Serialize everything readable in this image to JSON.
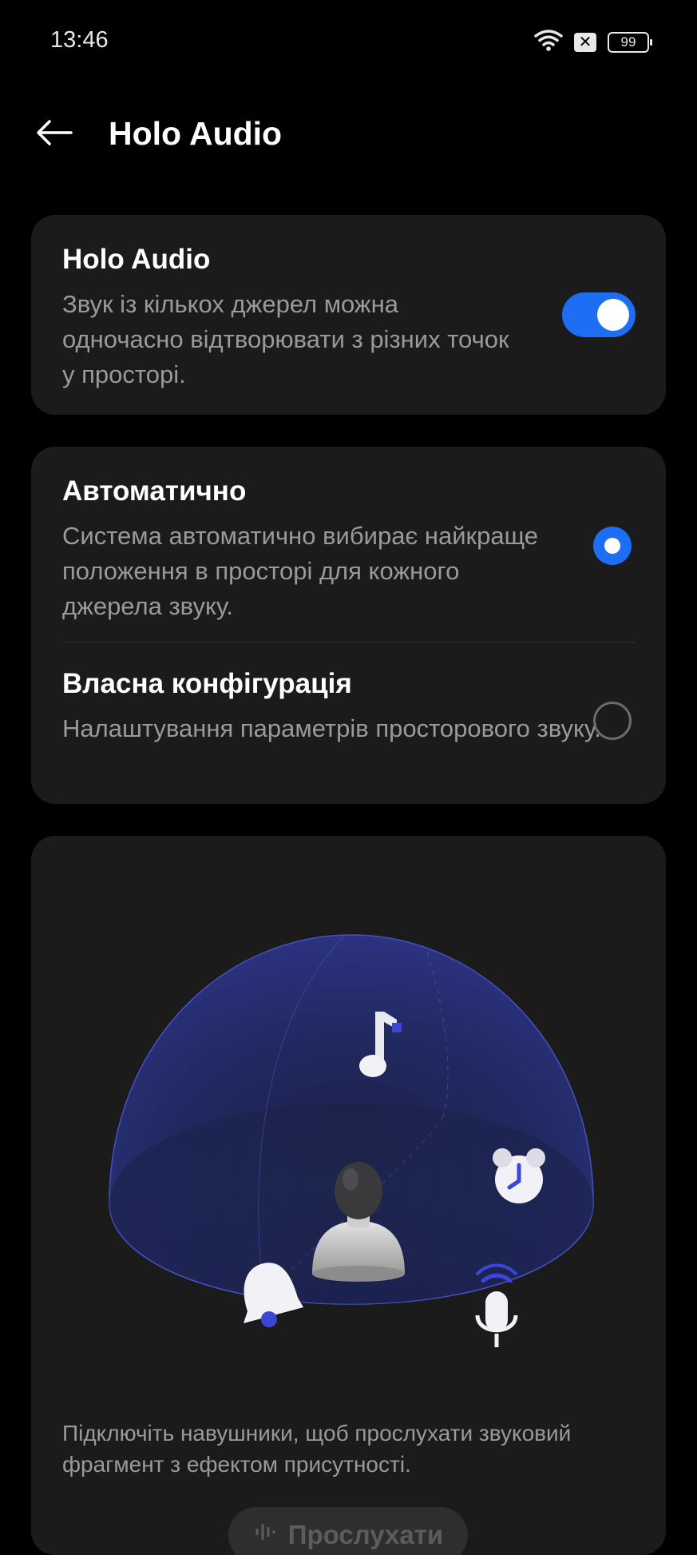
{
  "status_bar": {
    "time": "13:46",
    "battery": "99",
    "icons": [
      "wifi-icon",
      "sim-x-icon",
      "battery-icon"
    ]
  },
  "app_bar": {
    "title": "Holo Audio",
    "back_icon": "arrow-left-icon"
  },
  "holo_card": {
    "title": "Holo Audio",
    "description": "Звук із кількох джерел можна одночасно відтворювати з різних точок у просторі.",
    "toggle_on": true
  },
  "mode_card": {
    "options": [
      {
        "title": "Автоматично",
        "description": "Система автоматично вибирає найкраще положення в просторі для кожного джерела звуку.",
        "selected": true
      },
      {
        "title": "Власна конфігурація",
        "description": "Налаштування параметрів просторового звуку.",
        "selected": false
      }
    ]
  },
  "preview_card": {
    "hint": "Підключіть навушники, щоб прослухати звуковий фрагмент з ефектом присутності.",
    "play_label": "Прослухати",
    "illustration_icons": [
      "music-note-icon",
      "alarm-clock-icon",
      "person-icon",
      "bell-icon",
      "microphone-icon"
    ]
  },
  "colors": {
    "accent": "#1d6ef2",
    "background": "#000000",
    "card": "#1b1b1b",
    "secondary_text": "#9a9a9a",
    "dome": "#2a2f7a"
  }
}
